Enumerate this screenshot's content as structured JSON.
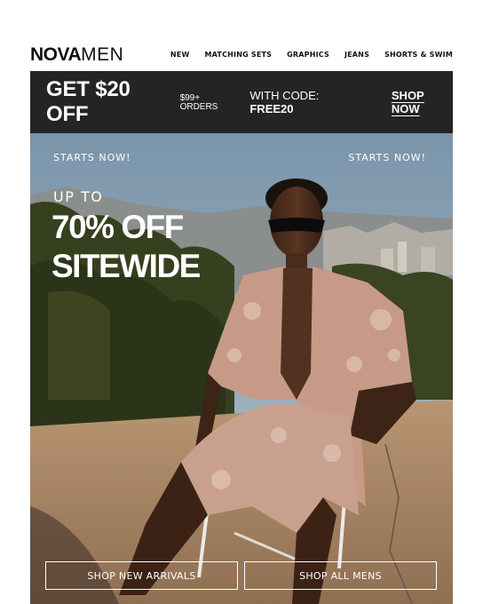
{
  "brand": {
    "logo_bold": "NOVA",
    "logo_light": "MEN"
  },
  "nav": {
    "items": [
      "NEW",
      "MATCHING SETS",
      "GRAPHICS",
      "JEANS",
      "SHORTS & SWIM"
    ]
  },
  "promo": {
    "headline": "GET $20 OFF",
    "minimum_line1": "$99+",
    "minimum_line2": "ORDERS",
    "code_prefix": "WITH CODE:",
    "code": "FREE20",
    "cta": "SHOP NOW"
  },
  "hero": {
    "starts_left": "STARTS NOW!",
    "starts_right": "STARTS NOW!",
    "up_to": "UP TO",
    "percent": "70% OFF",
    "scope": "SITEWIDE",
    "button_new": "SHOP NEW ARRIVALS",
    "button_all": "SHOP ALL MENS"
  },
  "colors": {
    "promo_bg": "#242424",
    "text_dark": "#111111",
    "hero_text": "#ffffff"
  }
}
